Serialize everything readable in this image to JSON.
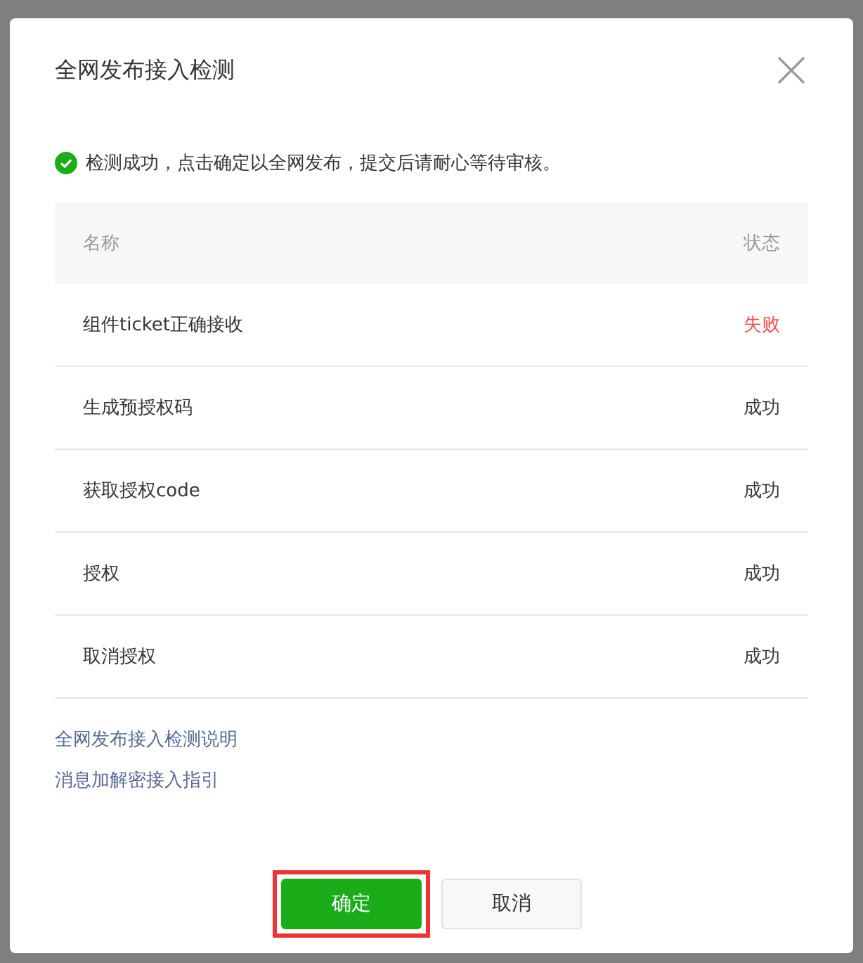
{
  "dialog": {
    "title": "全网发布接入检测",
    "message": "检测成功，点击确定以全网发布，提交后请耐心等待审核。",
    "table": {
      "columns": [
        "名称",
        "状态"
      ],
      "rows": [
        {
          "name": "组件ticket正确接收",
          "status": "失败",
          "kind": "fail"
        },
        {
          "name": "生成预授权码",
          "status": "成功",
          "kind": "ok"
        },
        {
          "name": "获取授权code",
          "status": "成功",
          "kind": "ok"
        },
        {
          "name": "授权",
          "status": "成功",
          "kind": "ok"
        },
        {
          "name": "取消授权",
          "status": "成功",
          "kind": "ok"
        }
      ]
    },
    "links": [
      "全网发布接入检测说明",
      "消息加解密接入指引"
    ],
    "buttons": [
      {
        "label": "确定",
        "kind": "primary",
        "highlighted": true
      },
      {
        "label": "取消",
        "kind": "default",
        "highlighted": false
      }
    ]
  }
}
